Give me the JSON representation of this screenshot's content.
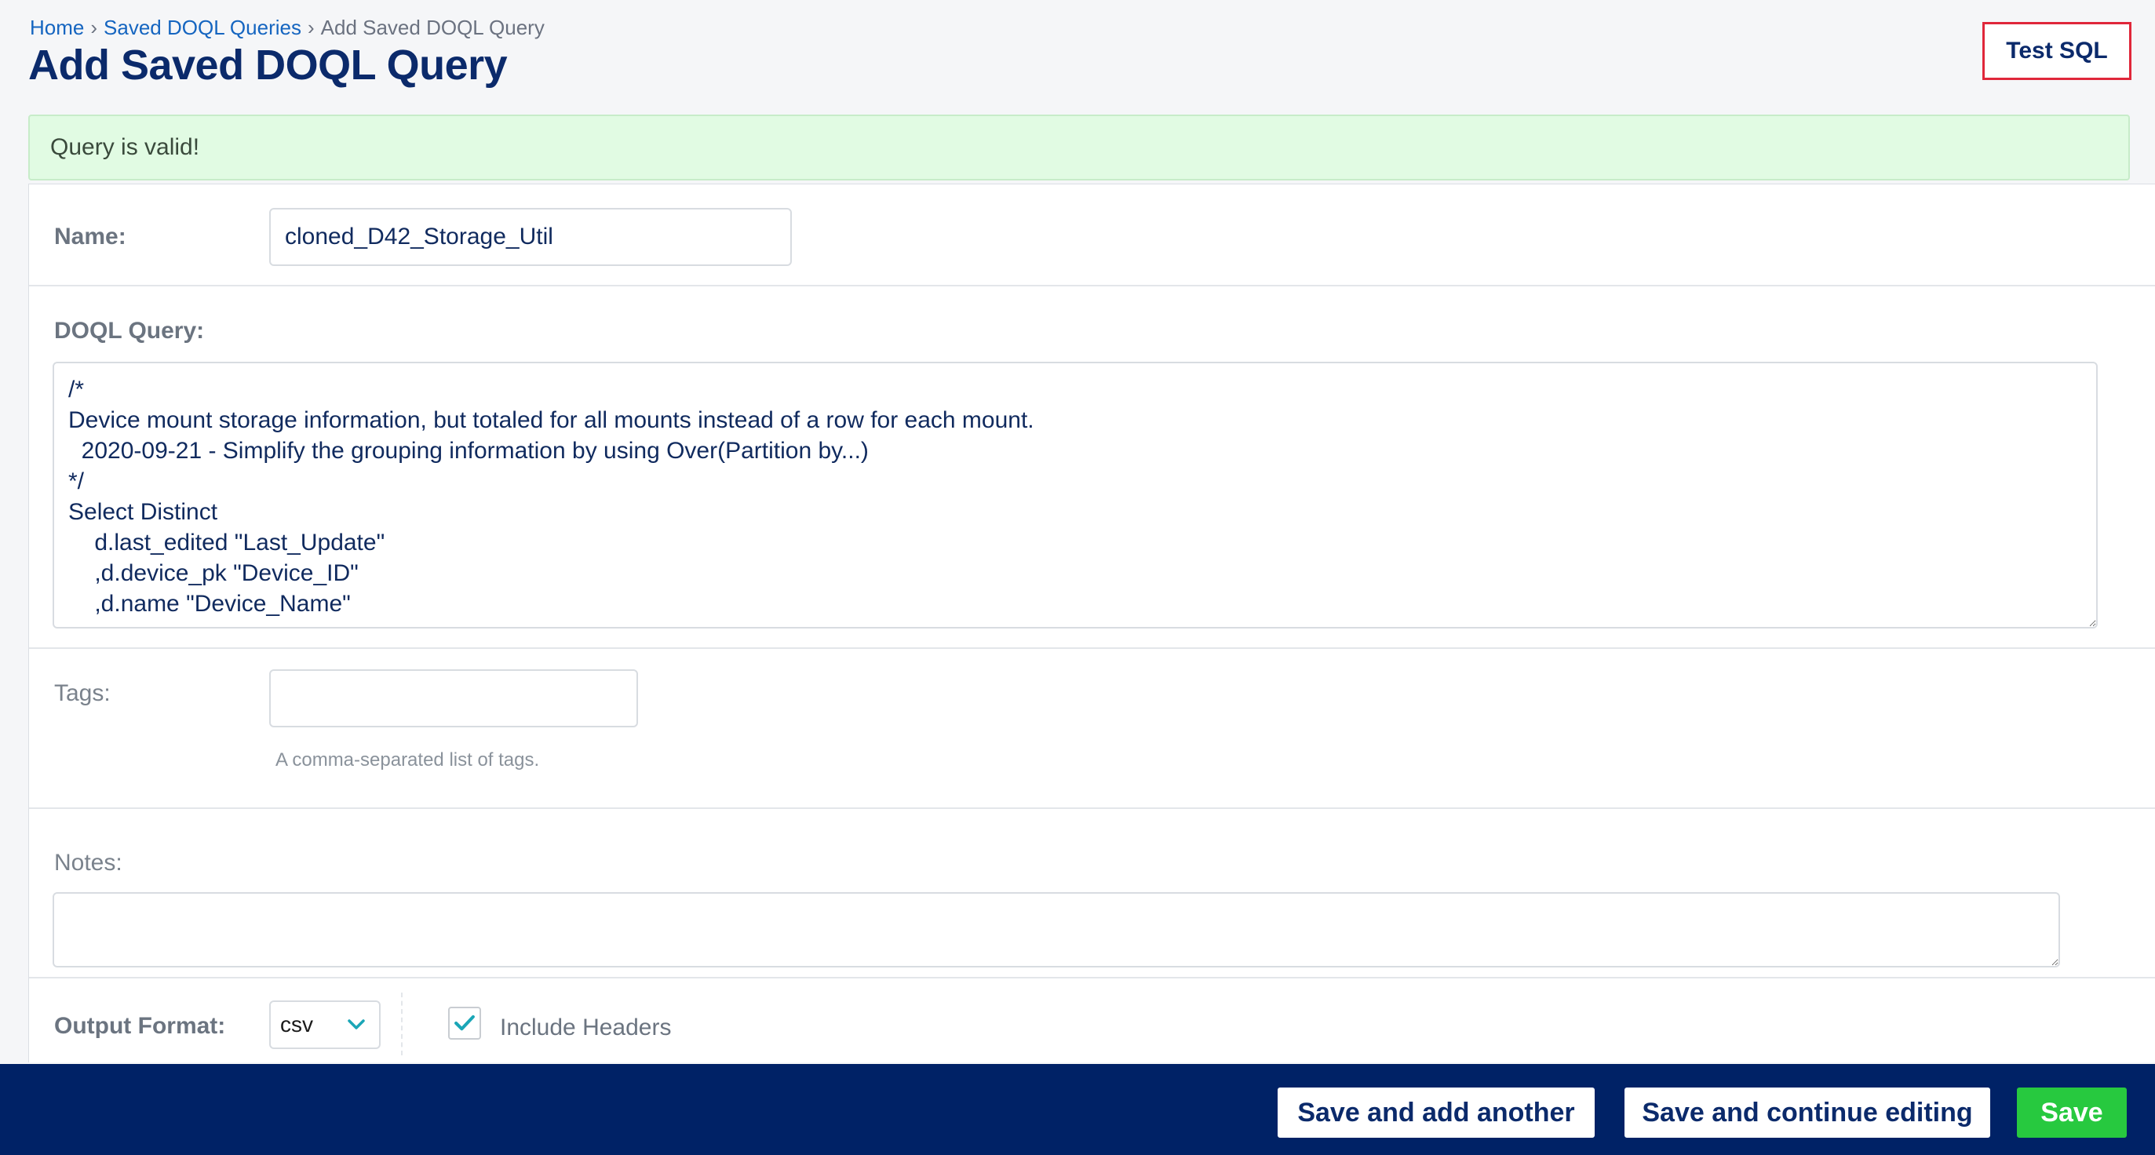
{
  "breadcrumb": {
    "home": "Home",
    "sep1": "›",
    "saved_queries": "Saved DOQL Queries",
    "sep2": "›",
    "current": "Add Saved DOQL Query"
  },
  "page_title": "Add Saved DOQL Query",
  "test_sql_label": "Test SQL",
  "message": "Query is valid!",
  "form": {
    "name_label": "Name:",
    "name_value": "cloned_D42_Storage_Util",
    "query_label": "DOQL Query:",
    "query_value": "/*\nDevice mount storage information, but totaled for all mounts instead of a row for each mount.\n  2020-09-21 - Simplify the grouping information by using Over(Partition by...)\n*/\nSelect Distinct\n    d.last_edited \"Last_Update\"\n    ,d.device_pk \"Device_ID\"\n    ,d.name \"Device_Name\"",
    "tags_label": "Tags:",
    "tags_value": "",
    "tags_help": "A comma-separated list of tags.",
    "notes_label": "Notes:",
    "notes_value": "",
    "output_format_label": "Output Format:",
    "output_format_value": "csv",
    "include_headers_label": "Include Headers",
    "include_headers_checked": true
  },
  "footer": {
    "save_add_another": "Save and add another",
    "save_continue": "Save and continue editing",
    "save": "Save"
  },
  "colors": {
    "header_navy": "#002266",
    "title_navy": "#0b2a6b",
    "link_blue": "#1565c0",
    "success_bg": "#e1fbe3",
    "save_green": "#27c93f",
    "highlight_red": "#e0273a",
    "check_teal": "#1aa6b7"
  }
}
